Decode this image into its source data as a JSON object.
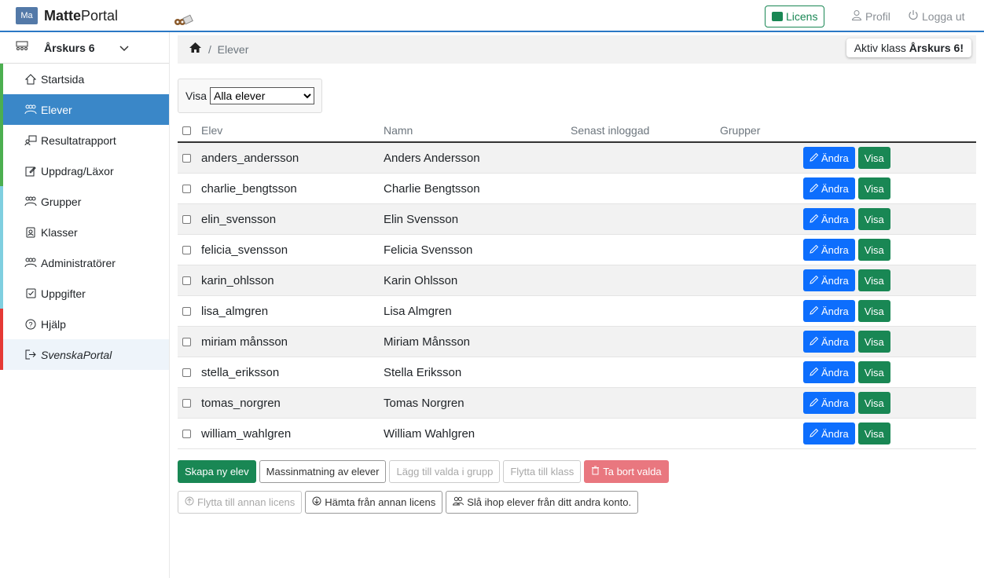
{
  "app": {
    "logo_badge": "Ma",
    "name_bold": "Matte",
    "name_rest": "Portal"
  },
  "topbar": {
    "license": "Licens",
    "profile": "Profil",
    "logout": "Logga ut"
  },
  "sidebar": {
    "class_name": "Årskurs 6",
    "items": [
      {
        "label": "Startsida",
        "icon": "home-icon",
        "color": "#4caf50"
      },
      {
        "label": "Elever",
        "icon": "users-icon",
        "color": "#4caf50"
      },
      {
        "label": "Resultatrapport",
        "icon": "report-icon",
        "color": "#4caf50"
      },
      {
        "label": "Uppdrag/Läxor",
        "icon": "edit-icon",
        "color": "#4caf50"
      },
      {
        "label": "Grupper",
        "icon": "users-icon",
        "color": "#7fcfe0"
      },
      {
        "label": "Klasser",
        "icon": "badge-icon",
        "color": "#7fcfe0"
      },
      {
        "label": "Administratörer",
        "icon": "users-icon",
        "color": "#7fcfe0"
      },
      {
        "label": "Uppgifter",
        "icon": "checkbox-icon",
        "color": "#7fcfe0"
      },
      {
        "label": "Hjälp",
        "icon": "help-icon",
        "color": "#e53935"
      },
      {
        "label": "SvenskaPortal",
        "icon": "exit-icon",
        "color": "#e53935"
      }
    ]
  },
  "breadcrumb": {
    "current": "Elever",
    "active_prefix": "Aktiv klass ",
    "active_class": "Årskurs 6!"
  },
  "filter": {
    "label": "Visa",
    "selected": "Alla elever"
  },
  "table": {
    "headers": {
      "user": "Elev",
      "name": "Namn",
      "last": "Senast inloggad",
      "groups": "Grupper"
    },
    "edit_label": "Ändra",
    "show_label": "Visa",
    "rows": [
      {
        "user": "anders_andersson",
        "name": "Anders Andersson"
      },
      {
        "user": "charlie_bengtsson",
        "name": "Charlie Bengtsson"
      },
      {
        "user": "elin_svensson",
        "name": "Elin Svensson"
      },
      {
        "user": "felicia_svensson",
        "name": "Felicia Svensson"
      },
      {
        "user": "karin_ohlsson",
        "name": "Karin Ohlsson"
      },
      {
        "user": "lisa_almgren",
        "name": "Lisa Almgren"
      },
      {
        "user": "miriam månsson",
        "name": "Miriam Månsson"
      },
      {
        "user": "stella_eriksson",
        "name": "Stella Eriksson"
      },
      {
        "user": "tomas_norgren",
        "name": "Tomas Norgren"
      },
      {
        "user": "william_wahlgren",
        "name": "William Wahlgren"
      }
    ]
  },
  "actions": {
    "create": "Skapa ny elev",
    "bulk": "Massinmatning av elever",
    "add_group": "Lägg till valda i grupp",
    "move_class": "Flytta till klass",
    "delete": "Ta bort valda",
    "move_license": "Flytta till annan licens",
    "fetch_license": "Hämta från annan licens",
    "merge": "Slå ihop elever från ditt andra konto."
  }
}
